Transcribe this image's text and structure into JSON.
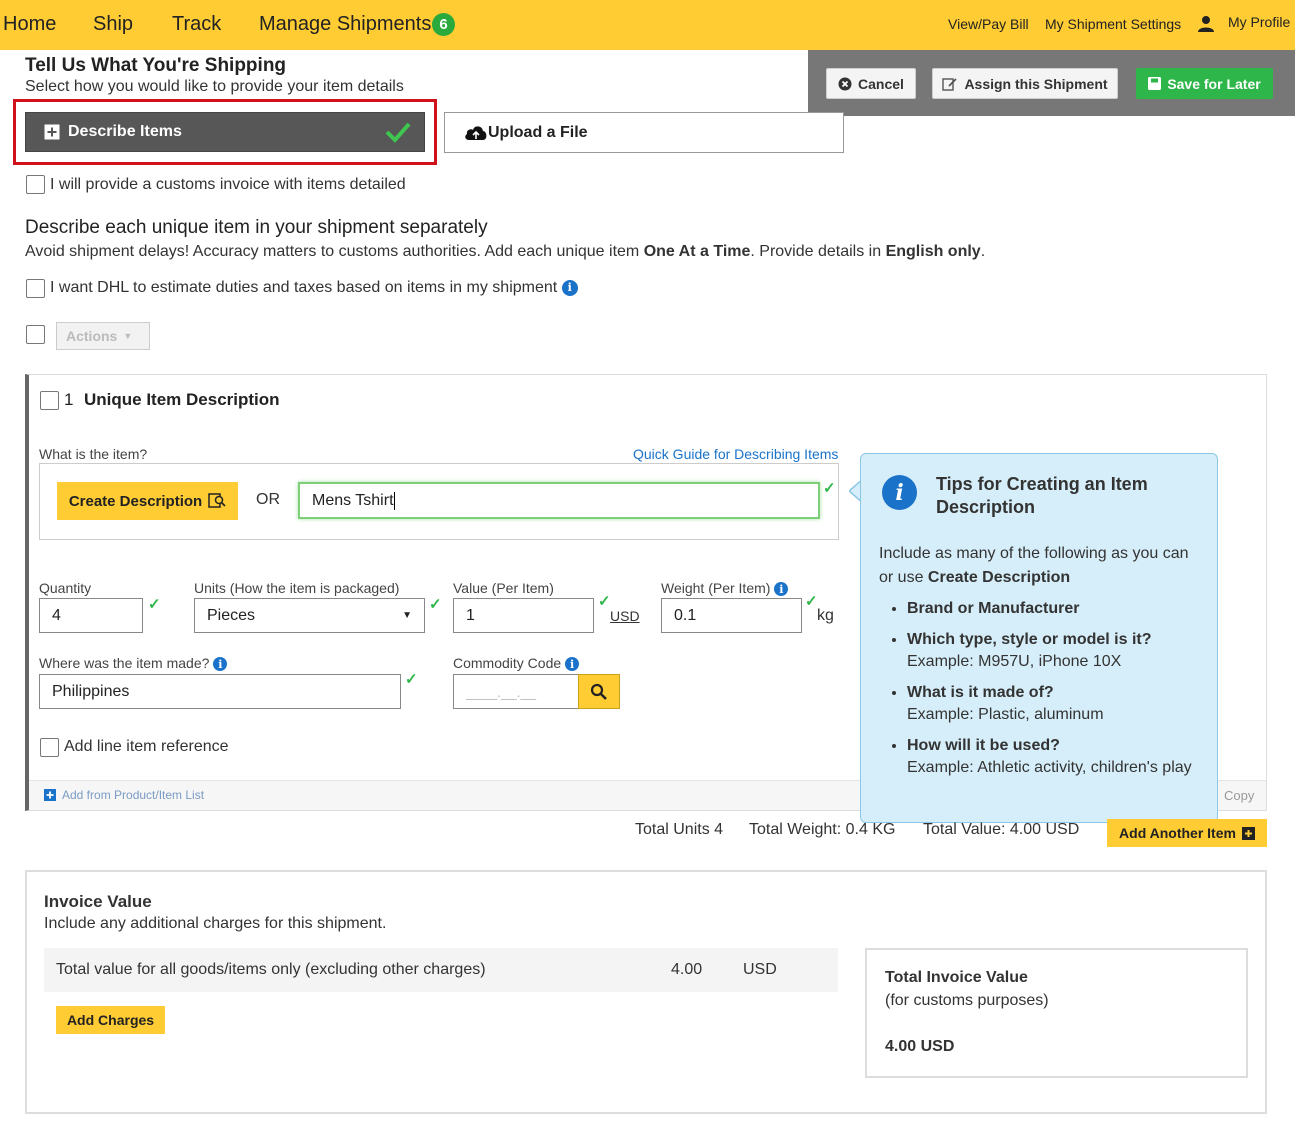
{
  "nav": {
    "home": "Home",
    "ship": "Ship",
    "track": "Track",
    "manage": "Manage Shipments",
    "manage_count": "6",
    "view_pay": "View/Pay Bill",
    "settings": "My Shipment Settings",
    "profile": "My Profile"
  },
  "actions": {
    "cancel": "Cancel",
    "assign": "Assign this Shipment",
    "save": "Save for Later"
  },
  "section": {
    "title": "Tell Us What You're Shipping",
    "subtitle": "Select how you would like to provide your item details",
    "describe_btn": "Describe Items",
    "upload_btn": "Upload a File",
    "customs_invoice": "I will provide a customs invoice with items detailed",
    "unique_title": "Describe each unique item in your shipment separately",
    "warn_prefix": "Avoid shipment delays! Accuracy matters to customs authorities.  Add each unique item ",
    "warn_bold1": "One At a Time",
    "warn_mid": ".  Provide details in ",
    "warn_bold2": "English only",
    "warn_end": ".",
    "estimate": "I want DHL to estimate duties and taxes based on items in my shipment",
    "actions_dropdown": "Actions"
  },
  "item": {
    "number": "1",
    "title": "Unique Item Description",
    "what_label": "What is the item?",
    "quick_guide": "Quick Guide for Describing Items",
    "create_desc": "Create Description",
    "or": "OR",
    "description": "Mens Tshirt",
    "qty_label": "Quantity",
    "qty": "4",
    "units_label": "Units (How the item is packaged)",
    "units": "Pieces",
    "value_label": "Value (Per Item)",
    "value": "1",
    "currency": "USD",
    "weight_label": "Weight (Per Item)",
    "weight": "0.1",
    "weight_unit": "kg",
    "made_label": "Where was the item made?",
    "made": "Philippines",
    "commodity_label": "Commodity Code",
    "commodity_placeholder": "____.__.__",
    "line_ref": "Add line item reference",
    "add_from_list": "Add from Product/Item List",
    "copy": "Copy"
  },
  "tips": {
    "title": "Tips for Creating an Item Description",
    "intro1": "Include as many of the following as you can",
    "intro2_prefix": "or use ",
    "intro2_bold": "Create Description",
    "b1": "Brand or Manufacturer",
    "b2": "Which type, style or model is it?",
    "b2_ex": "Example: M957U, iPhone 10X",
    "b3": "What is it made of?",
    "b3_ex": "Example: Plastic, aluminum",
    "b4": "How will it be used?",
    "b4_ex": "Example: Athletic activity, children's play"
  },
  "totals": {
    "units_label": "Total Units",
    "units": "4",
    "weight_label": "Total Weight:",
    "weight": "0.4 KG",
    "value_label": "Total Value:",
    "value": "4.00 USD",
    "add_another": "Add Another Item"
  },
  "invoice": {
    "title": "Invoice Value",
    "subtitle": "Include any additional charges for this shipment.",
    "row_label": "Total value for all goods/items only (excluding other charges)",
    "row_value": "4.00",
    "row_currency": "USD",
    "add_charges": "Add Charges",
    "total_title": "Total Invoice Value",
    "total_sub": "(for customs purposes)",
    "total_value": "4.00 USD"
  },
  "colors": {
    "dhl_yellow": "#FFCC33",
    "green": "#2fb64a",
    "highlight_red": "#d0101b",
    "link_blue": "#1a73c9"
  }
}
